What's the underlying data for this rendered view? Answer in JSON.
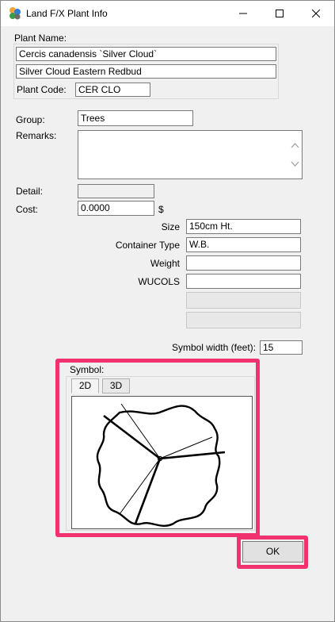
{
  "window": {
    "title": "Land F/X Plant Info"
  },
  "plant": {
    "name_label": "Plant Name:",
    "botanical_name": "Cercis canadensis `Silver Cloud`",
    "common_name": "Silver Cloud Eastern Redbud",
    "code_label": "Plant Code:",
    "code_value": "CER CLO"
  },
  "form": {
    "group_label": "Group:",
    "group_value": "Trees",
    "remarks_label": "Remarks:",
    "remarks_value": "",
    "detail_label": "Detail:",
    "detail_value": "",
    "cost_label": "Cost:",
    "cost_value": "0.0000",
    "currency_symbol": "$",
    "size_label": "Size",
    "size_value": "150cm Ht.",
    "container_label": "Container Type",
    "container_value": "W.B.",
    "weight_label": "Weight",
    "weight_value": "",
    "wucols_label": "WUCOLS",
    "wucols_value": "",
    "extra1_value": "",
    "extra2_value": "",
    "symbol_width_label": "Symbol width (feet):",
    "symbol_width_value": "15"
  },
  "symbol": {
    "label": "Symbol:",
    "tabs": [
      {
        "label": "2D",
        "active": true
      },
      {
        "label": "3D",
        "active": false
      }
    ]
  },
  "buttons": {
    "ok_label": "OK"
  },
  "colors": {
    "highlight": "#f0326e"
  },
  "icons": {
    "app": "land-fx-app-icon",
    "minimize": "minimize-icon",
    "maximize": "maximize-icon",
    "close": "close-icon",
    "scroll_up": "chevron-up-icon",
    "scroll_down": "chevron-down-icon"
  }
}
